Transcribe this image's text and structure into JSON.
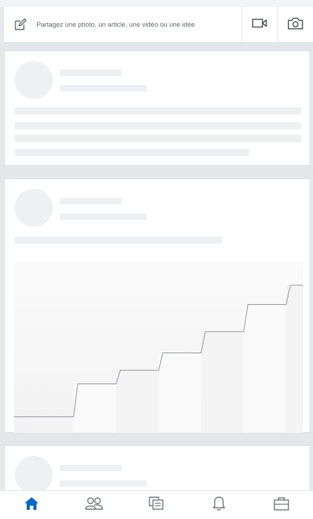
{
  "share_bar": {
    "placeholder": "Partagez une photo, un article, une vidéo ou une idée",
    "icons": [
      "compose-icon",
      "video-camera-icon",
      "camera-icon"
    ]
  },
  "feed": {
    "cards": [
      {
        "state": "loading-skeleton",
        "has_media": false
      },
      {
        "state": "loading-skeleton",
        "has_media": true
      },
      {
        "state": "loading-skeleton",
        "has_media": false
      }
    ]
  },
  "chart_data": {
    "type": "line",
    "shape": "step",
    "x": [
      1,
      2,
      3,
      4,
      5,
      6,
      7
    ],
    "y": [
      1.0,
      2.7,
      3.4,
      4.3,
      5.4,
      6.8,
      7.8
    ],
    "ylim": [
      0,
      9
    ],
    "title": "",
    "xlabel": "",
    "ylabel": ""
  },
  "bottom_nav": {
    "items": [
      {
        "icon": "home-icon",
        "active": true
      },
      {
        "icon": "my-network-icon",
        "active": false
      },
      {
        "icon": "messaging-icon",
        "active": false
      },
      {
        "icon": "notifications-bell-icon",
        "active": false
      },
      {
        "icon": "jobs-briefcase-icon",
        "active": false
      }
    ]
  },
  "colors": {
    "active_nav": "#0a66c2",
    "inactive_icon": "#6b7074",
    "skeleton": "#eeeff1",
    "background": "#e6e9ec"
  }
}
